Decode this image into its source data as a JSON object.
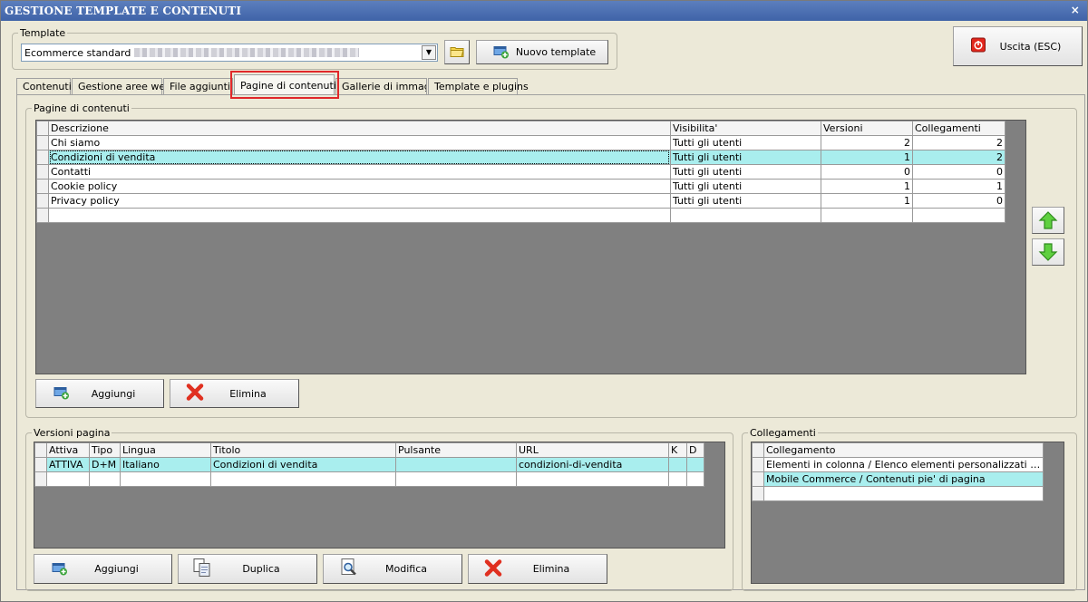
{
  "window": {
    "title": "GESTIONE TEMPLATE E CONTENUTI",
    "close_glyph": "×"
  },
  "template": {
    "legend": "Template",
    "selected": "Ecommerce standard",
    "folder_icon": "folder-icon",
    "new_button": "Nuovo template",
    "exit_button": "Uscita (ESC)"
  },
  "tabs": [
    {
      "label": "Contenuti"
    },
    {
      "label": "Gestione aree web"
    },
    {
      "label": "File aggiuntivi"
    },
    {
      "label": "Pagine di contenuti"
    },
    {
      "label": "Gallerie di immagini"
    },
    {
      "label": "Template e plugins"
    }
  ],
  "active_tab": "Pagine di contenuti",
  "pages": {
    "legend": "Pagine di contenuti",
    "columns": [
      "Descrizione",
      "Visibilita'",
      "Versioni",
      "Collegamenti"
    ],
    "rows": [
      {
        "descrizione": "Chi siamo",
        "visibilita": "Tutti gli utenti",
        "versioni": "2",
        "collegamenti": "2"
      },
      {
        "descrizione": "Condizioni di vendita",
        "visibilita": "Tutti gli utenti",
        "versioni": "1",
        "collegamenti": "2"
      },
      {
        "descrizione": "Contatti",
        "visibilita": "Tutti gli utenti",
        "versioni": "0",
        "collegamenti": "0"
      },
      {
        "descrizione": "Cookie policy",
        "visibilita": "Tutti gli utenti",
        "versioni": "1",
        "collegamenti": "1"
      },
      {
        "descrizione": "Privacy policy",
        "visibilita": "Tutti gli utenti",
        "versioni": "1",
        "collegamenti": "0"
      }
    ],
    "selected_row": 1,
    "add_button": "Aggiungi",
    "delete_button": "Elimina"
  },
  "versions": {
    "legend": "Versioni pagina",
    "columns": [
      "Attiva",
      "Tipo",
      "Lingua",
      "Titolo",
      "Pulsante",
      "URL",
      "K",
      "D"
    ],
    "rows": [
      {
        "attiva": "ATTIVA",
        "tipo": "D+M",
        "lingua": "Italiano",
        "titolo": "Condizioni di vendita",
        "pulsante": "",
        "url": "condizioni-di-vendita",
        "k": "",
        "d": ""
      }
    ],
    "add_button": "Aggiungi",
    "duplicate_button": "Duplica",
    "edit_button": "Modifica",
    "delete_button": "Elimina"
  },
  "links": {
    "legend": "Collegamenti",
    "columns": [
      "Collegamento"
    ],
    "rows": [
      {
        "collegamento": "Elementi in colonna / Elenco elementi personalizzati su colonna"
      },
      {
        "collegamento": "Mobile Commerce / Contenuti pie' di pagina"
      }
    ]
  },
  "colors": {
    "selected_row": "#a9eeee",
    "titlebar": "#3f63a8",
    "highlight": "#e0282a"
  }
}
